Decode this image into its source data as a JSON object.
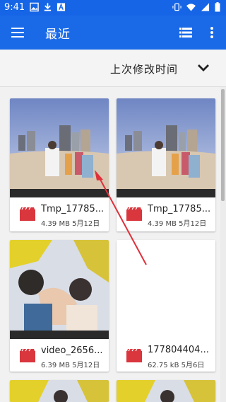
{
  "status_bar": {
    "time": "9:41",
    "left_icons": [
      "image-icon",
      "download-icon",
      "app-a-icon"
    ],
    "right_icons": [
      "vibrate-icon",
      "wifi-icon",
      "signal-icon",
      "battery-icon"
    ]
  },
  "app_bar": {
    "title": "最近",
    "menu_icon": "menu-icon",
    "view_icon": "list-view-icon",
    "more_icon": "more-vert-icon",
    "color": "#1a6ae8"
  },
  "sort": {
    "label": "上次修改时间",
    "icon": "chevron-down-icon"
  },
  "files": [
    {
      "name": "Tmp_17785...",
      "size": "4.39 MB",
      "date": "5月12日",
      "type": "video"
    },
    {
      "name": "Tmp_17785...",
      "size": "4.39 MB",
      "date": "5月12日",
      "type": "video"
    },
    {
      "name": "video_2656...",
      "size": "6.39 MB",
      "date": "5月12日",
      "type": "video"
    },
    {
      "name": "177804404...",
      "size": "62.75 kB",
      "date": "5月6日",
      "type": "video"
    }
  ]
}
